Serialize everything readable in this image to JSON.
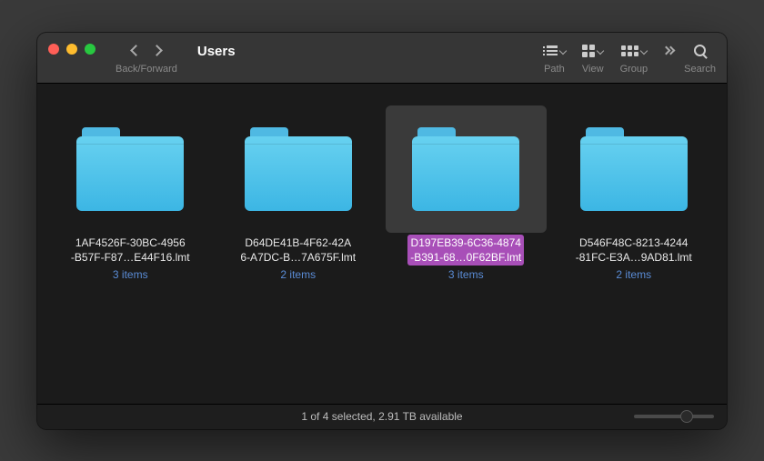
{
  "window": {
    "title": "Users"
  },
  "toolbar": {
    "back_forward_label": "Back/Forward",
    "path_label": "Path",
    "view_label": "View",
    "group_label": "Group",
    "search_label": "Search"
  },
  "items": [
    {
      "name_line1": "1AF4526F-30BC-4956",
      "name_line2": "-B57F-F87…E44F16.lmt",
      "meta": "3 items",
      "selected": false
    },
    {
      "name_line1": "D64DE41B-4F62-42A",
      "name_line2": "6-A7DC-B…7A675F.lmt",
      "meta": "2 items",
      "selected": false
    },
    {
      "name_line1": "D197EB39-6C36-4874",
      "name_line2": "-B391-68…0F62BF.lmt",
      "meta": "3 items",
      "selected": true
    },
    {
      "name_line1": "D546F48C-8213-4244",
      "name_line2": "-81FC-E3A…9AD81.lmt",
      "meta": "2 items",
      "selected": false
    }
  ],
  "status": "1 of 4 selected, 2.91 TB available"
}
